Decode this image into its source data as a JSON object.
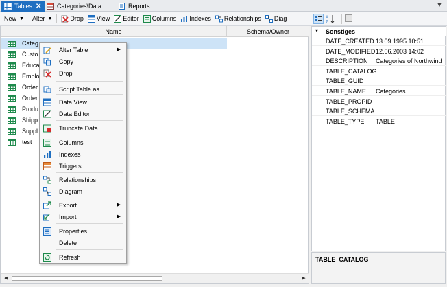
{
  "tabs": [
    {
      "label": "Tables",
      "active": true,
      "icon": "table-grid-icon",
      "closable": true
    },
    {
      "label": "Categories\\Data",
      "active": false,
      "icon": "data-view-icon"
    },
    {
      "label": "Reports",
      "active": false,
      "icon": "report-icon"
    }
  ],
  "toolbar": {
    "new_label": "New",
    "alter_label": "Alter",
    "drop_label": "Drop",
    "view_label": "View",
    "editor_label": "Editor",
    "columns_label": "Columns",
    "indexes_label": "Indexes",
    "relationships_label": "Relationships",
    "diagram_label": "Diag"
  },
  "list": {
    "columns": [
      "Name",
      "Schema/Owner"
    ],
    "rows": [
      "Categ",
      "Custo",
      "Educa",
      "Emplo",
      "Order",
      "Order",
      "Produ",
      "Shipp",
      "Suppl",
      "test"
    ],
    "selected_index": 0
  },
  "context_menu": {
    "items": [
      {
        "label": "Alter Table",
        "icon": "alter-table-icon",
        "submenu": true
      },
      {
        "label": "Copy",
        "icon": "copy-icon"
      },
      {
        "label": "Drop",
        "icon": "drop-icon"
      },
      {
        "label": "Script Table as",
        "icon": "script-icon"
      },
      {
        "label": "Data View",
        "icon": "data-view-icon"
      },
      {
        "label": "Data Editor",
        "icon": "data-editor-icon"
      },
      {
        "label": "Truncate Data",
        "icon": "truncate-icon"
      },
      {
        "label": "Columns",
        "icon": "columns-icon"
      },
      {
        "label": "Indexes",
        "icon": "indexes-icon"
      },
      {
        "label": "Triggers",
        "icon": "triggers-icon"
      },
      {
        "label": "Relationships",
        "icon": "relationships-icon"
      },
      {
        "label": "Diagram",
        "icon": "diagram-icon"
      },
      {
        "label": "Export",
        "icon": "export-icon",
        "submenu": true
      },
      {
        "label": "Import",
        "icon": "import-icon",
        "submenu": true
      },
      {
        "label": "Properties",
        "icon": "properties-icon"
      },
      {
        "label": "Delete",
        "icon": "delete-icon"
      },
      {
        "label": "Refresh",
        "icon": "refresh-icon"
      }
    ]
  },
  "properties": {
    "category": "Sonstiges",
    "rows": [
      {
        "name": "DATE_CREATED",
        "value": "13.09.1995 10:51"
      },
      {
        "name": "DATE_MODIFIED",
        "value": "12.06.2003 14:02"
      },
      {
        "name": "DESCRIPTION",
        "value": "Categories of Northwind"
      },
      {
        "name": "TABLE_CATALOG",
        "value": ""
      },
      {
        "name": "TABLE_GUID",
        "value": ""
      },
      {
        "name": "TABLE_NAME",
        "value": "Categories"
      },
      {
        "name": "TABLE_PROPID",
        "value": ""
      },
      {
        "name": "TABLE_SCHEMA",
        "value": ""
      },
      {
        "name": "TABLE_TYPE",
        "value": "TABLE"
      }
    ],
    "description_title": "TABLE_CATALOG"
  },
  "colors": {
    "accent": "#1f6fc1",
    "selection": "#cde3f7",
    "grid_icon": "#1e8a4c"
  }
}
